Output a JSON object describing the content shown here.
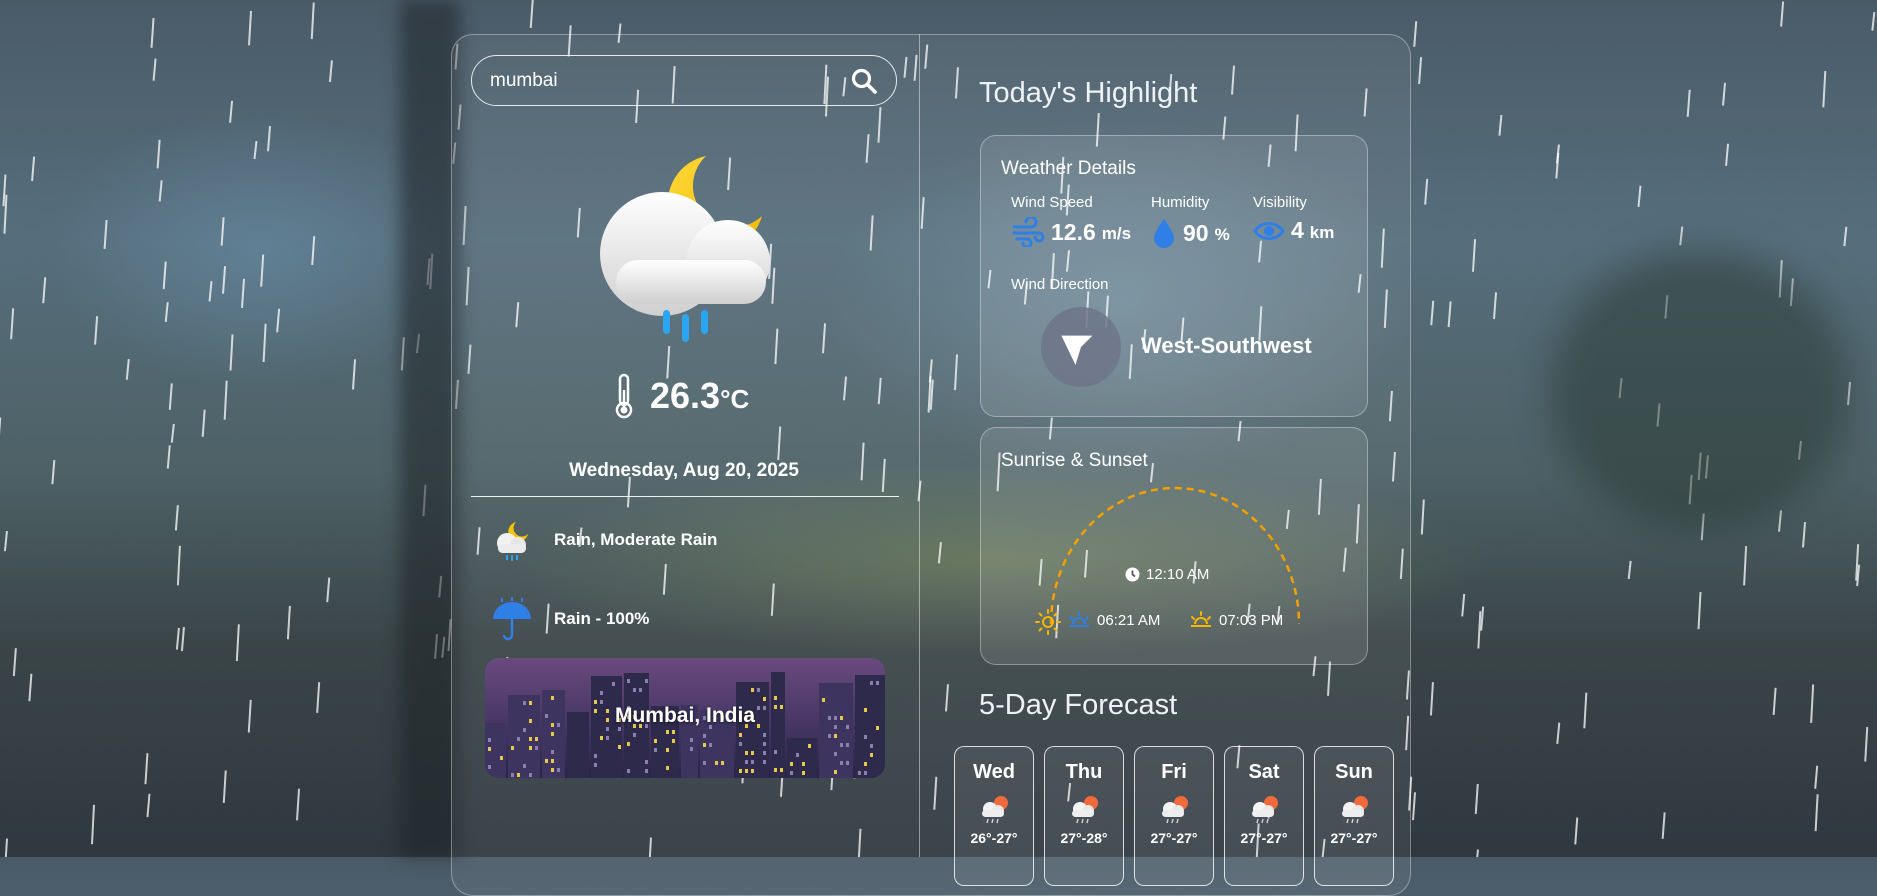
{
  "search": {
    "value": "mumbai"
  },
  "current": {
    "temperature": "26.3",
    "unit": "°C",
    "date": "Wednesday, Aug 20, 2025",
    "condition": "Rain, Moderate Rain",
    "rain_chance": "Rain - 100%",
    "location": "Mumbai, India"
  },
  "highlights": {
    "heading": "Today's Highlight",
    "weather_details": {
      "title": "Weather Details",
      "wind_speed": {
        "label": "Wind Speed",
        "value": "12.6",
        "unit": "m/s"
      },
      "humidity": {
        "label": "Humidity",
        "value": "90",
        "unit": "%"
      },
      "visibility": {
        "label": "Visibility",
        "value": "4",
        "unit": "km"
      },
      "wind_direction": {
        "label": "Wind Direction",
        "value": "West-Southwest"
      }
    },
    "sun": {
      "title": "Sunrise & Sunset",
      "current_time": "12:10 AM",
      "sunrise": "06:21 AM",
      "sunset": "07:03 PM"
    }
  },
  "forecast": {
    "heading": "5-Day Forecast",
    "days": [
      {
        "day": "Wed",
        "range": "26°-27°"
      },
      {
        "day": "Thu",
        "range": "27°-28°"
      },
      {
        "day": "Fri",
        "range": "27°-27°"
      },
      {
        "day": "Sat",
        "range": "27°-27°"
      },
      {
        "day": "Sun",
        "range": "27°-27°"
      }
    ]
  },
  "colors": {
    "accent_blue": "#2f7fe6",
    "sun_yellow": "#f5b700",
    "arc_orange": "#f5a000"
  },
  "icons": [
    "search-icon",
    "night-rain-cloud-icon",
    "thermometer-icon",
    "umbrella-icon",
    "wind-icon",
    "droplet-icon",
    "eye-icon",
    "navigation-arrow-icon",
    "clock-icon",
    "sunrise-icon",
    "sunset-icon"
  ]
}
